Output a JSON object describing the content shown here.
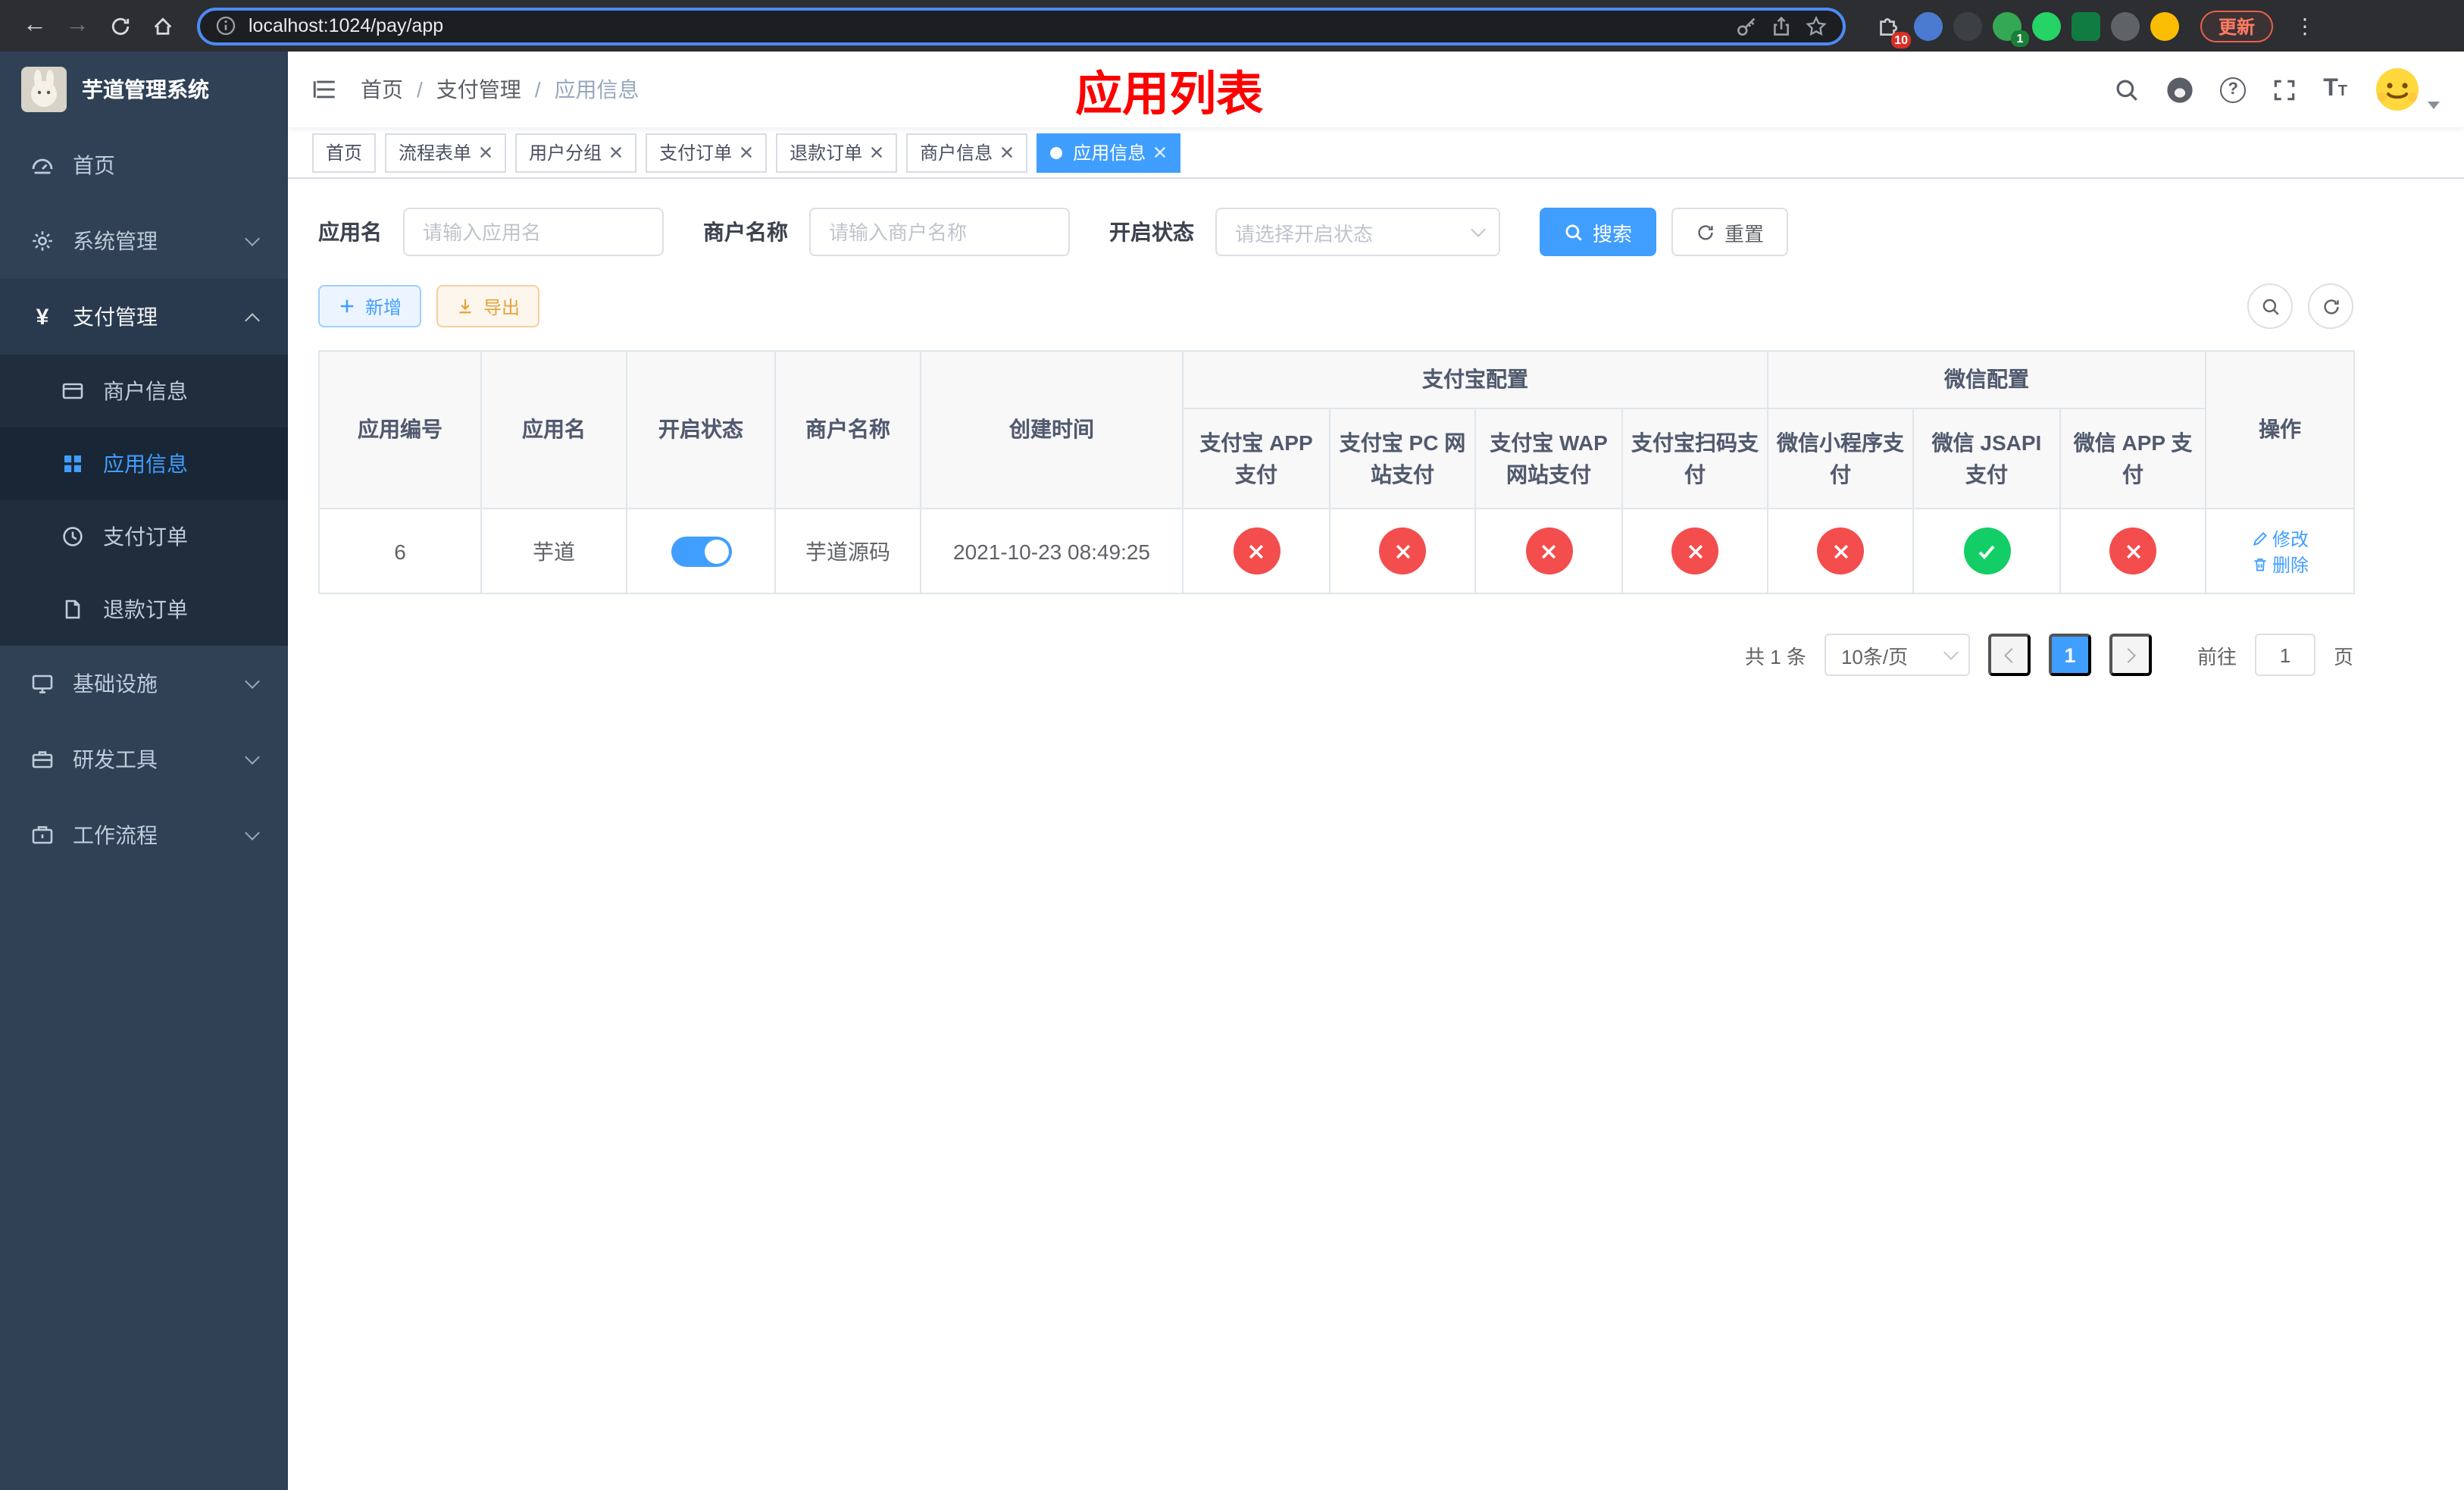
{
  "browser": {
    "url": "localhost:1024/pay/app",
    "update_button": "更新",
    "ext_badge_puzzle": "10",
    "ext_badge_green": "1"
  },
  "icons": {
    "pay_symbol": "¥",
    "question_mark": "?",
    "font_size_large": "T",
    "font_size_small": "T",
    "kebab": "⋮",
    "back_arrow": "←",
    "forward_arrow": "→"
  },
  "sidebar": {
    "logo_title": "芋道管理系统",
    "items": [
      {
        "label": "首页"
      },
      {
        "label": "系统管理"
      },
      {
        "label": "支付管理"
      },
      {
        "label": "基础设施"
      },
      {
        "label": "研发工具"
      },
      {
        "label": "工作流程"
      }
    ],
    "payment_children": [
      {
        "label": "商户信息"
      },
      {
        "label": "应用信息"
      },
      {
        "label": "支付订单"
      },
      {
        "label": "退款订单"
      }
    ]
  },
  "header": {
    "breadcrumb": [
      "首页",
      "支付管理",
      "应用信息"
    ],
    "page_title": "应用列表"
  },
  "tabs": [
    {
      "label": "首页"
    },
    {
      "label": "流程表单"
    },
    {
      "label": "用户分组"
    },
    {
      "label": "支付订单"
    },
    {
      "label": "退款订单"
    },
    {
      "label": "商户信息"
    },
    {
      "label": "应用信息"
    }
  ],
  "filters": {
    "app_name_label": "应用名",
    "app_name_placeholder": "请输入应用名",
    "merchant_label": "商户名称",
    "merchant_placeholder": "请输入商户名称",
    "status_label": "开启状态",
    "status_placeholder": "请选择开启状态",
    "search_button": "搜索",
    "reset_button": "重置"
  },
  "toolbar": {
    "add_button": "新增",
    "export_button": "导出"
  },
  "table": {
    "group_alipay": "支付宝配置",
    "group_wechat": "微信配置",
    "columns": [
      "应用编号",
      "应用名",
      "开启状态",
      "商户名称",
      "创建时间",
      "支付宝 APP 支付",
      "支付宝 PC 网站支付",
      "支付宝 WAP 网站支付",
      "支付宝扫码支付",
      "微信小程序支付",
      "微信 JSAPI 支付",
      "微信 APP 支付",
      "操作"
    ],
    "rows": [
      {
        "id": "6",
        "name": "芋道",
        "enabled": true,
        "merchant": "芋道源码",
        "created": "2021-10-23 08:49:25",
        "alipay_app": false,
        "alipay_pc": false,
        "alipay_wap": false,
        "alipay_qr": false,
        "wechat_mini": false,
        "wechat_jsapi": true,
        "wechat_app": false,
        "edit_label": "修改",
        "delete_label": "删除"
      }
    ]
  },
  "pagination": {
    "total": "共 1 条",
    "page_size": "10条/页",
    "current_page": "1",
    "goto_label": "前往",
    "goto_value": "1",
    "page_unit": "页"
  },
  "colors": {
    "primary": "#409eff",
    "success": "#13ce66",
    "danger": "#f34d4d",
    "warning": "#e6a23c",
    "sidebar_bg": "#304156",
    "title_red": "#fe0000"
  }
}
